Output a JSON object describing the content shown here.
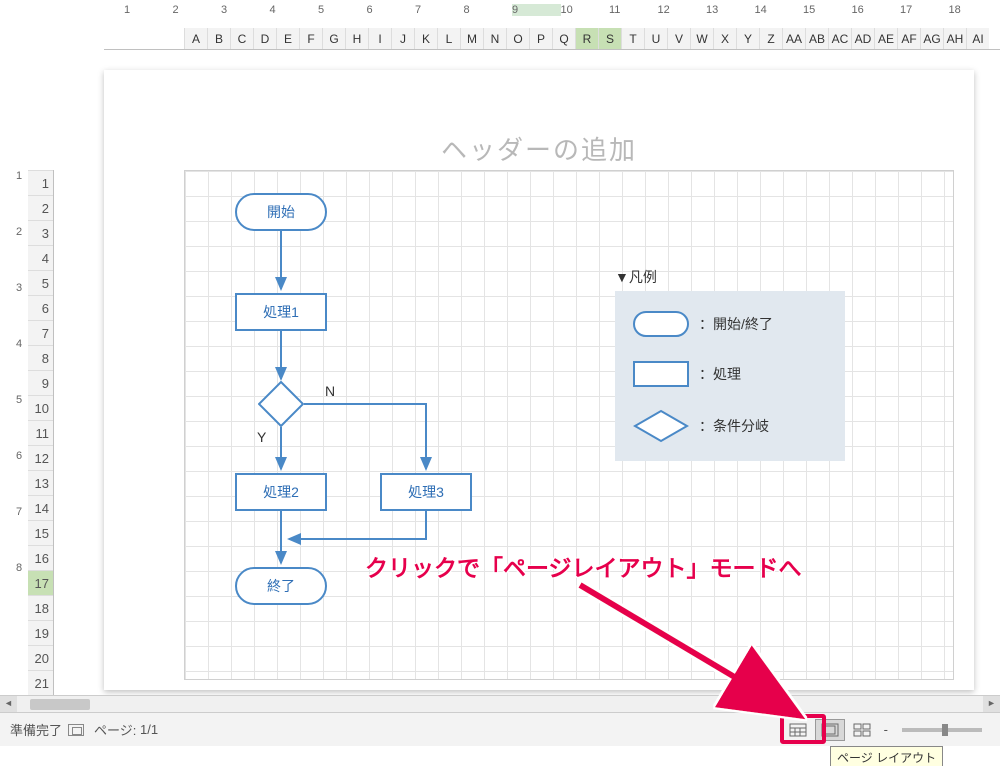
{
  "ruler_h": [
    "1",
    "2",
    "3",
    "4",
    "5",
    "6",
    "7",
    "8",
    "9",
    "10",
    "11",
    "12",
    "13",
    "14",
    "15",
    "16",
    "17",
    "18"
  ],
  "ruler_h_highlight_idx": 8,
  "columns": [
    "A",
    "B",
    "C",
    "D",
    "E",
    "F",
    "G",
    "H",
    "I",
    "J",
    "K",
    "L",
    "M",
    "N",
    "O",
    "P",
    "Q",
    "R",
    "S",
    "T",
    "U",
    "V",
    "W",
    "X",
    "Y",
    "Z",
    "AA",
    "AB",
    "AC",
    "AD",
    "AE",
    "AF",
    "AG",
    "AH",
    "AI"
  ],
  "col_selected": [
    17,
    18
  ],
  "ruler_v": [
    "1",
    "2",
    "3",
    "4",
    "5",
    "6",
    "7",
    "8"
  ],
  "rows": [
    "1",
    "2",
    "3",
    "4",
    "5",
    "6",
    "7",
    "8",
    "9",
    "10",
    "11",
    "12",
    "13",
    "14",
    "15",
    "16",
    "17",
    "18",
    "19",
    "20",
    "21"
  ],
  "row_selected": 16,
  "header_placeholder": "ヘッダーの追加",
  "flow": {
    "start": "開始",
    "p1": "処理1",
    "p2": "処理2",
    "p3": "処理3",
    "end": "終了",
    "branch_n": "N",
    "branch_y": "Y"
  },
  "legend": {
    "title": "▼凡例",
    "terminator": "：開始/終了",
    "process": "：処理",
    "decision": "：条件分岐"
  },
  "annotation": "クリックで「ページレイアウト」モードへ",
  "status": {
    "ready": "準備完了",
    "page_label": "ページ:",
    "page_value": "1/1",
    "zoom_minus": "-",
    "zoom_plus": "+"
  },
  "tooltip": "ページ レイアウト"
}
